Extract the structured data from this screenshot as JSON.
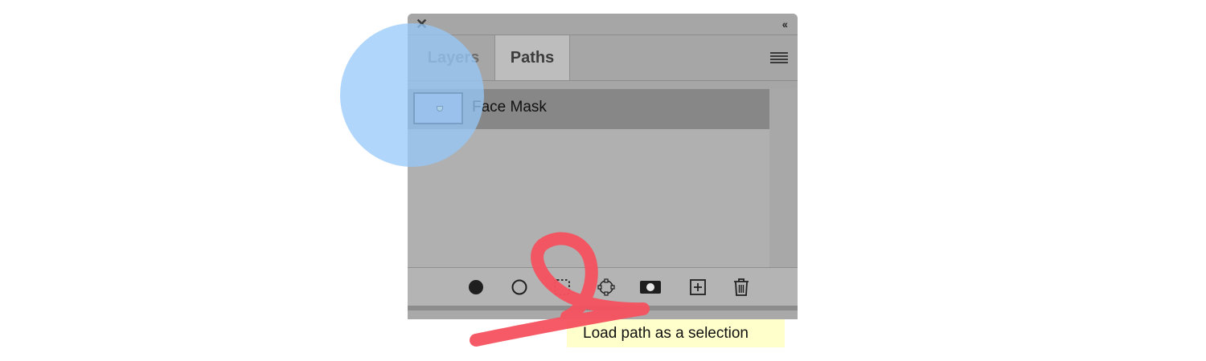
{
  "panel": {
    "tabs": [
      {
        "label": "Layers",
        "active": false
      },
      {
        "label": "Paths",
        "active": true
      }
    ],
    "paths": [
      {
        "name": "Face Mask"
      }
    ],
    "footer_buttons": [
      {
        "name": "fill-path-icon"
      },
      {
        "name": "stroke-path-icon"
      },
      {
        "name": "load-selection-icon"
      },
      {
        "name": "make-work-path-icon"
      },
      {
        "name": "add-mask-icon"
      },
      {
        "name": "new-path-icon"
      },
      {
        "name": "delete-path-icon"
      }
    ]
  },
  "tooltip": {
    "text": "Load path as a selection"
  },
  "colors": {
    "panel_bg": "#a6a6a6",
    "selected_row": "#878787",
    "tooltip_bg": "#ffffcc",
    "highlight": "#96c8fa",
    "scribble": "#f4515e"
  }
}
